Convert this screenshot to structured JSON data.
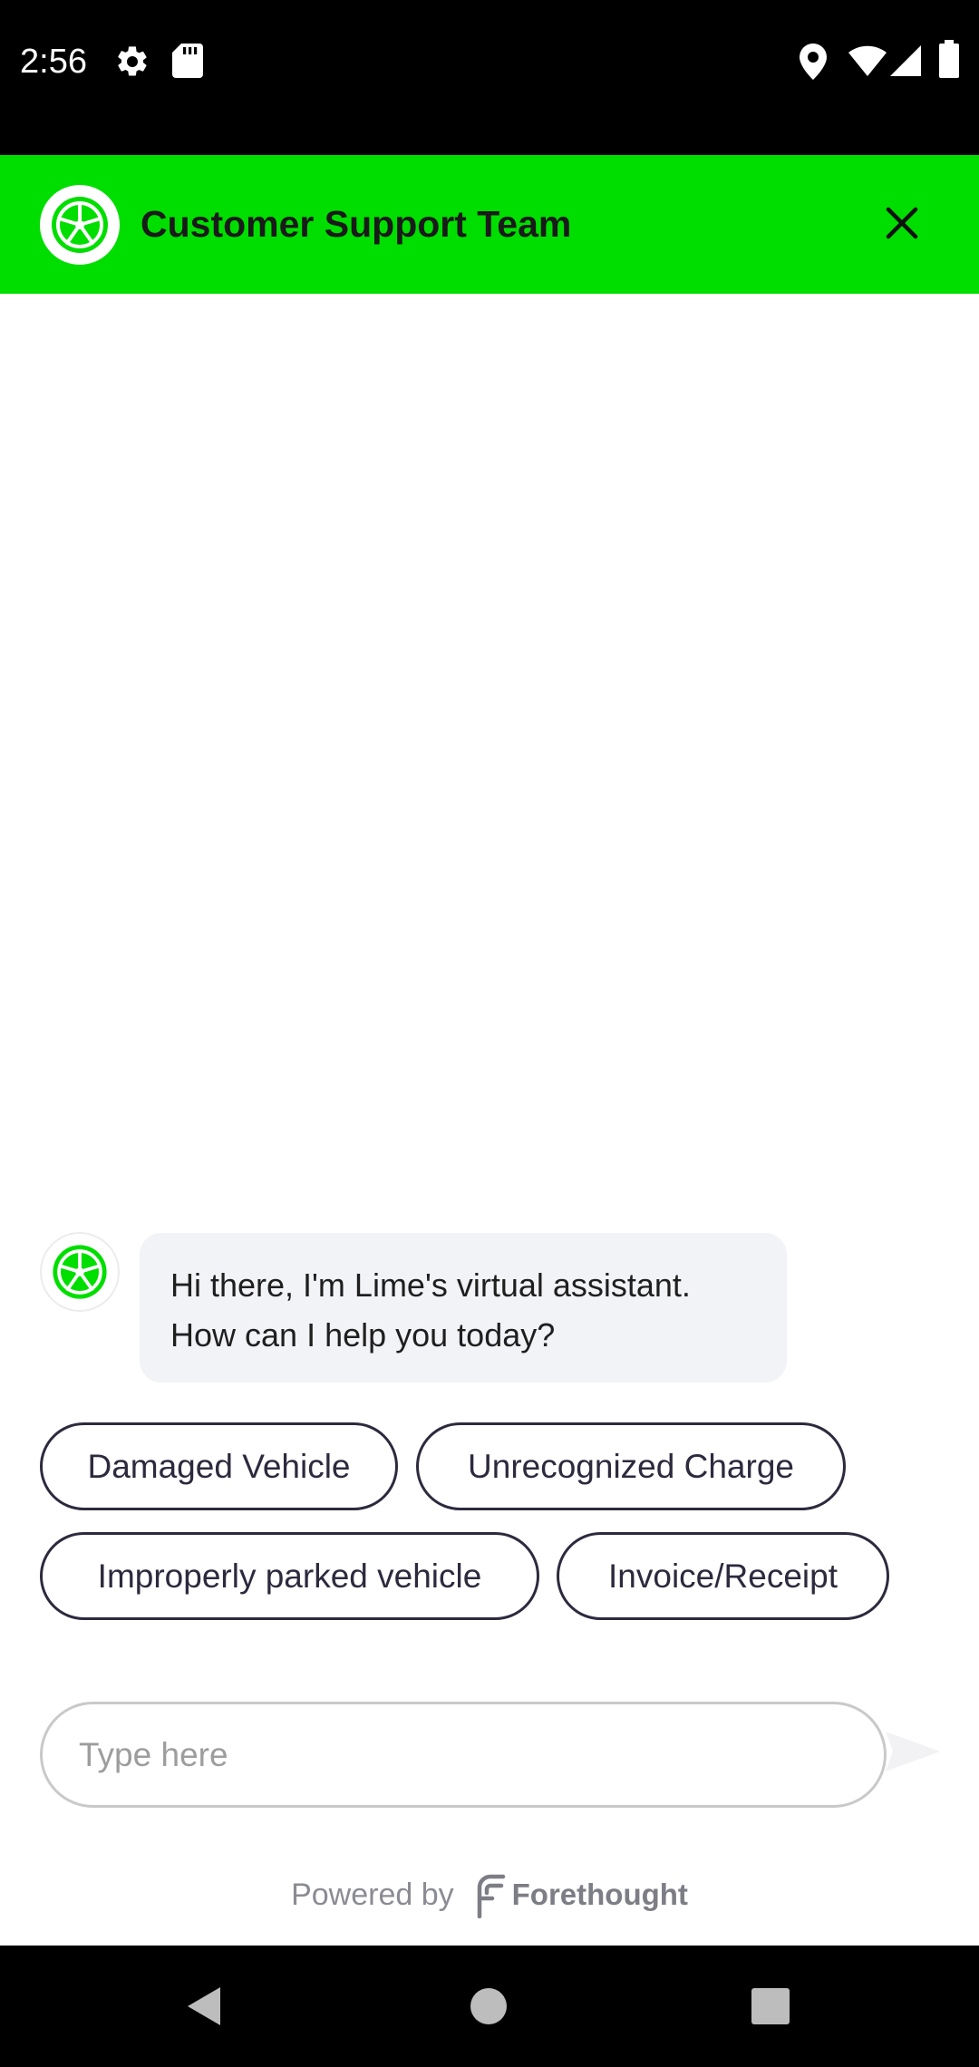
{
  "status_bar": {
    "time": "2:56",
    "left_icons": [
      "gear-icon",
      "sd-card-icon"
    ],
    "right_icons": [
      "location-icon",
      "wifi-icon",
      "signal-icon",
      "battery-icon"
    ]
  },
  "header": {
    "title": "Customer Support Team",
    "avatar_icon": "lime-logo-icon",
    "close_icon": "close-icon",
    "background_color": "#00de00"
  },
  "messages": [
    {
      "sender": "bot",
      "avatar_icon": "lime-logo-icon",
      "lines": [
        "Hi there, I'm Lime's virtual assistant.",
        "How can I help you today?"
      ]
    }
  ],
  "quick_replies": [
    "Damaged Vehicle",
    "Unrecognized Charge",
    "Improperly parked vehicle",
    "Invoice/Receipt"
  ],
  "composer": {
    "placeholder": "Type here",
    "value": "",
    "send_icon": "send-icon"
  },
  "footer": {
    "powered_by": "Powered by",
    "brand": "Forethought",
    "brand_icon": "forethought-logo-icon"
  },
  "nav_bar": {
    "icons": [
      "back-icon",
      "home-icon",
      "recents-icon"
    ]
  },
  "colors": {
    "accent": "#00de00",
    "chip_border": "#2d2a3e",
    "bubble_bg": "#f2f3f7"
  }
}
